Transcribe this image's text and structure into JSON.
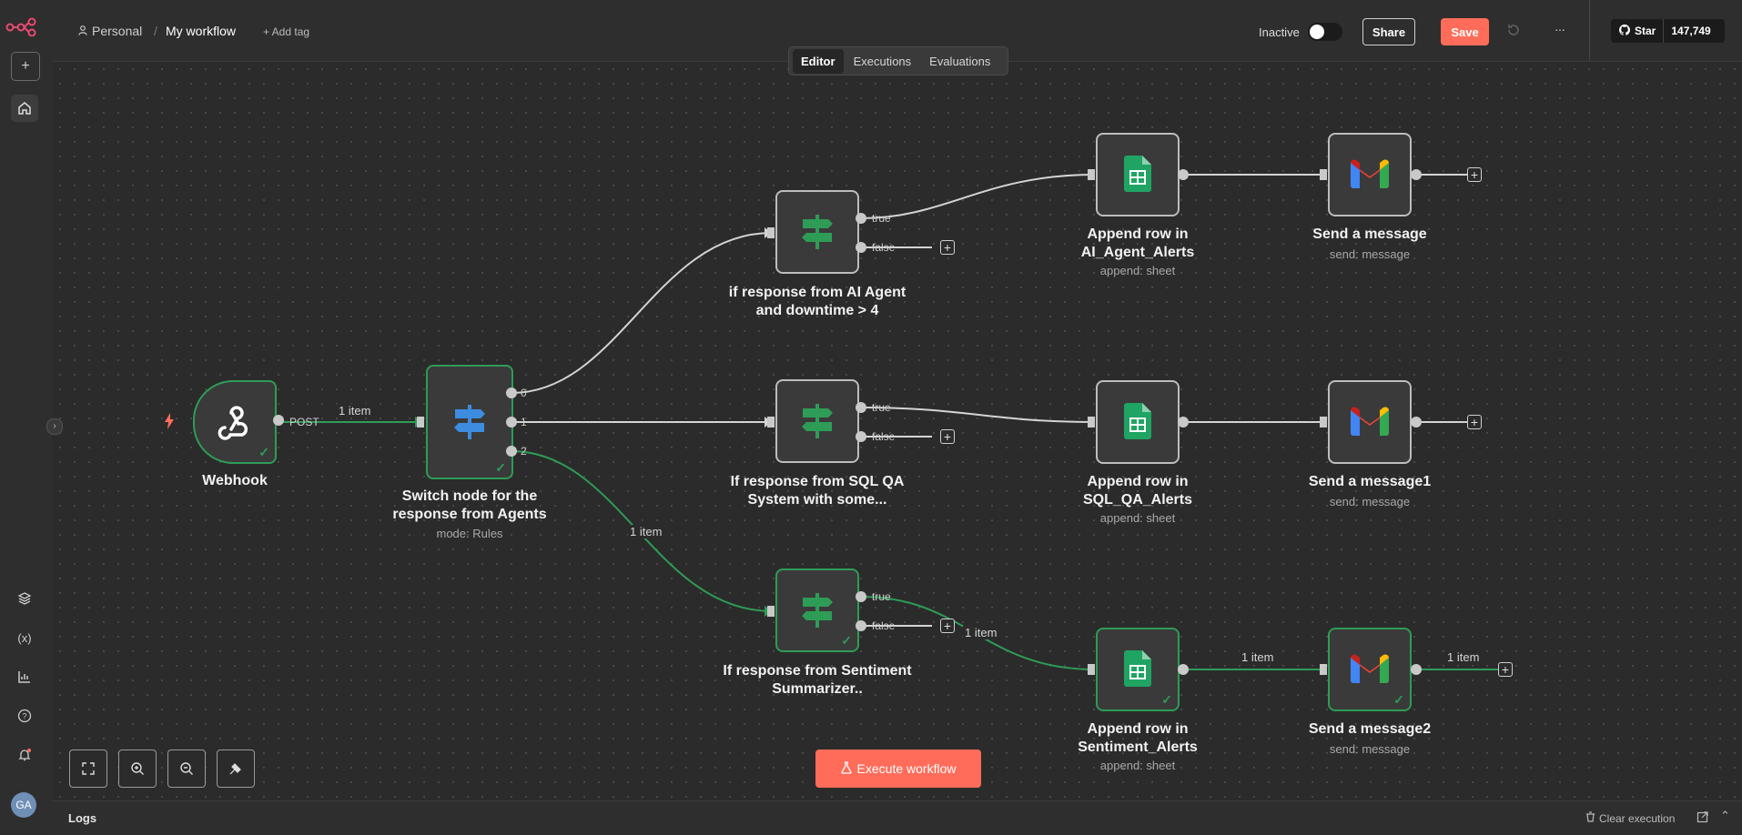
{
  "header": {
    "project_label": "Personal",
    "workflow_name": "My workflow",
    "add_tag_label": "+ Add tag",
    "status_label": "Inactive",
    "share_label": "Share",
    "save_label": "Save",
    "more_label": "···",
    "github_star_label": "Star",
    "github_star_count": "147,749"
  },
  "tabs": [
    {
      "label": "Editor",
      "active": true
    },
    {
      "label": "Executions",
      "active": false
    },
    {
      "label": "Evaluations",
      "active": false
    }
  ],
  "nodes": {
    "webhook": {
      "title": "Webhook",
      "port_label": "POST"
    },
    "switch": {
      "title": "Switch node for the response from Agents",
      "subtitle": "mode: Rules",
      "outputs": [
        "0",
        "1",
        "2"
      ]
    },
    "if1": {
      "title": "if response from AI Agent and downtime > 4"
    },
    "if2": {
      "title": "If response from SQL QA System with some..."
    },
    "if3": {
      "title": "If response from Sentiment Summarizer.."
    },
    "append1": {
      "title": "Append row in AI_Agent_Alerts",
      "subtitle": "append: sheet"
    },
    "append2": {
      "title": "Append row in SQL_QA_Alerts",
      "subtitle": "append: sheet"
    },
    "append3": {
      "title": "Append row in Sentiment_Alerts",
      "subtitle": "append: sheet"
    },
    "send1": {
      "title": "Send a message",
      "subtitle": "send: message"
    },
    "send2": {
      "title": "Send a message1",
      "subtitle": "send: message"
    },
    "send3": {
      "title": "Send a message2",
      "subtitle": "send: message"
    }
  },
  "port_labels": {
    "true": "true",
    "false": "false"
  },
  "edge_labels": {
    "item": "1 item"
  },
  "execute_button_label": "Execute workflow",
  "footer": {
    "logs_label": "Logs",
    "clear_label": "Clear execution"
  },
  "user_initials": "GA",
  "colors": {
    "accent": "#ff6d5a",
    "success": "#2e9c56",
    "sheets": "#1fa463",
    "switch": "#3e8ce0"
  }
}
